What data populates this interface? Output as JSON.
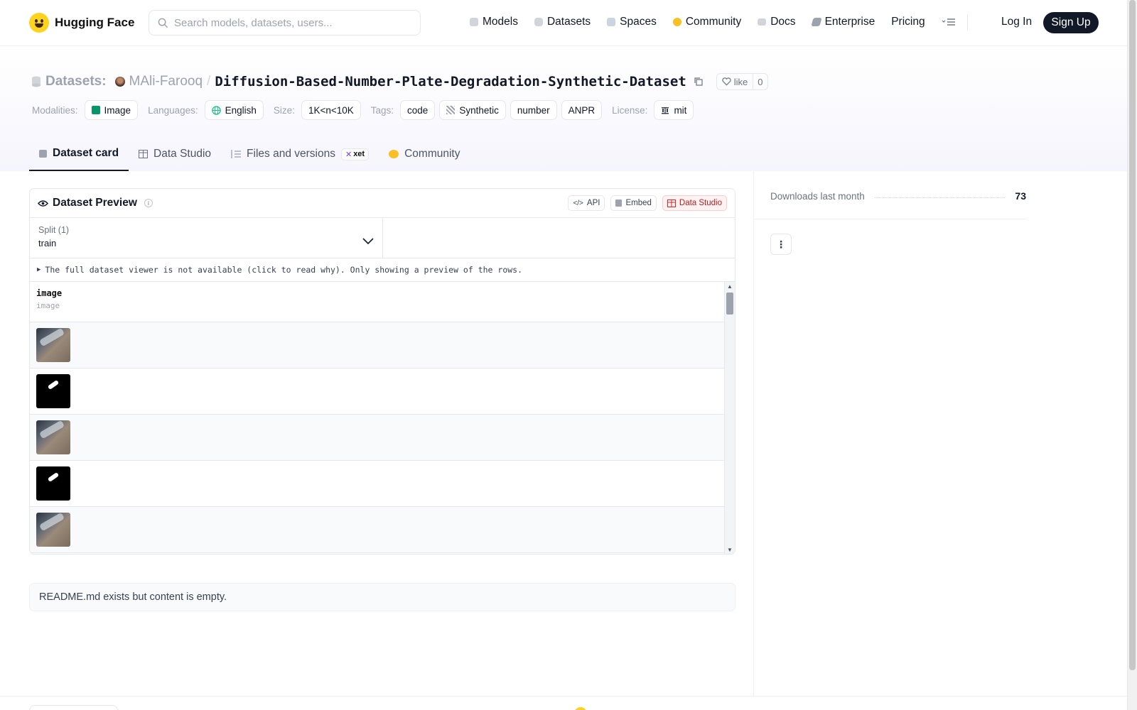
{
  "header": {
    "brand": "Hugging Face",
    "search_placeholder": "Search models, datasets, users...",
    "nav": [
      {
        "label": "Models",
        "icon": "cube-icon",
        "color": "#9ca3af"
      },
      {
        "label": "Datasets",
        "icon": "database-icon",
        "color": "#9ca3af"
      },
      {
        "label": "Spaces",
        "icon": "grid-icon",
        "color": "#9ca3af"
      },
      {
        "label": "Community",
        "icon": "community-icon",
        "color": "#fbbf24"
      },
      {
        "label": "Docs",
        "icon": "book-icon",
        "color": "#9ca3af"
      },
      {
        "label": "Enterprise",
        "icon": "enterprise-icon",
        "color": "#9ca3af"
      },
      {
        "label": "Pricing",
        "icon": "",
        "color": ""
      }
    ],
    "login": "Log In",
    "signup": "Sign Up"
  },
  "repo": {
    "section": "Datasets:",
    "owner": "MAli-Farooq",
    "separator": "/",
    "name": "Diffusion-Based-Number-Plate-Degradation-Synthetic-Dataset",
    "like_label": "like",
    "like_count": "0"
  },
  "meta": {
    "modalities_label": "Modalities:",
    "modality": "Image",
    "languages_label": "Languages:",
    "language": "English",
    "size_label": "Size:",
    "size": "1K<n<10K",
    "tags_label": "Tags:",
    "tags": [
      "code",
      "Synthetic",
      "number",
      "ANPR"
    ],
    "license_label": "License:",
    "license": "mit"
  },
  "tabs": [
    {
      "label": "Dataset card",
      "icon": "dataset-card-icon",
      "active": true
    },
    {
      "label": "Data Studio",
      "icon": "table-icon",
      "active": false
    },
    {
      "label": "Files and versions",
      "icon": "files-icon",
      "active": false,
      "badge": "xet"
    },
    {
      "label": "Community",
      "icon": "community-icon",
      "active": false
    }
  ],
  "preview": {
    "title": "Dataset Preview",
    "api": "API",
    "embed": "Embed",
    "studio": "Data Studio",
    "split_label": "Split (1)",
    "split_value": "train",
    "notice": "The full dataset viewer is not available (click to read why). Only showing a preview of the rows.",
    "column_name": "image",
    "column_type": "image",
    "rows": [
      "car-plate-image",
      "mask-image",
      "car-plate-image",
      "mask-image",
      "car-plate-image"
    ]
  },
  "readme": "README.md exists but content is empty.",
  "sidebar": {
    "downloads_label": "Downloads last month",
    "downloads_value": "73"
  }
}
